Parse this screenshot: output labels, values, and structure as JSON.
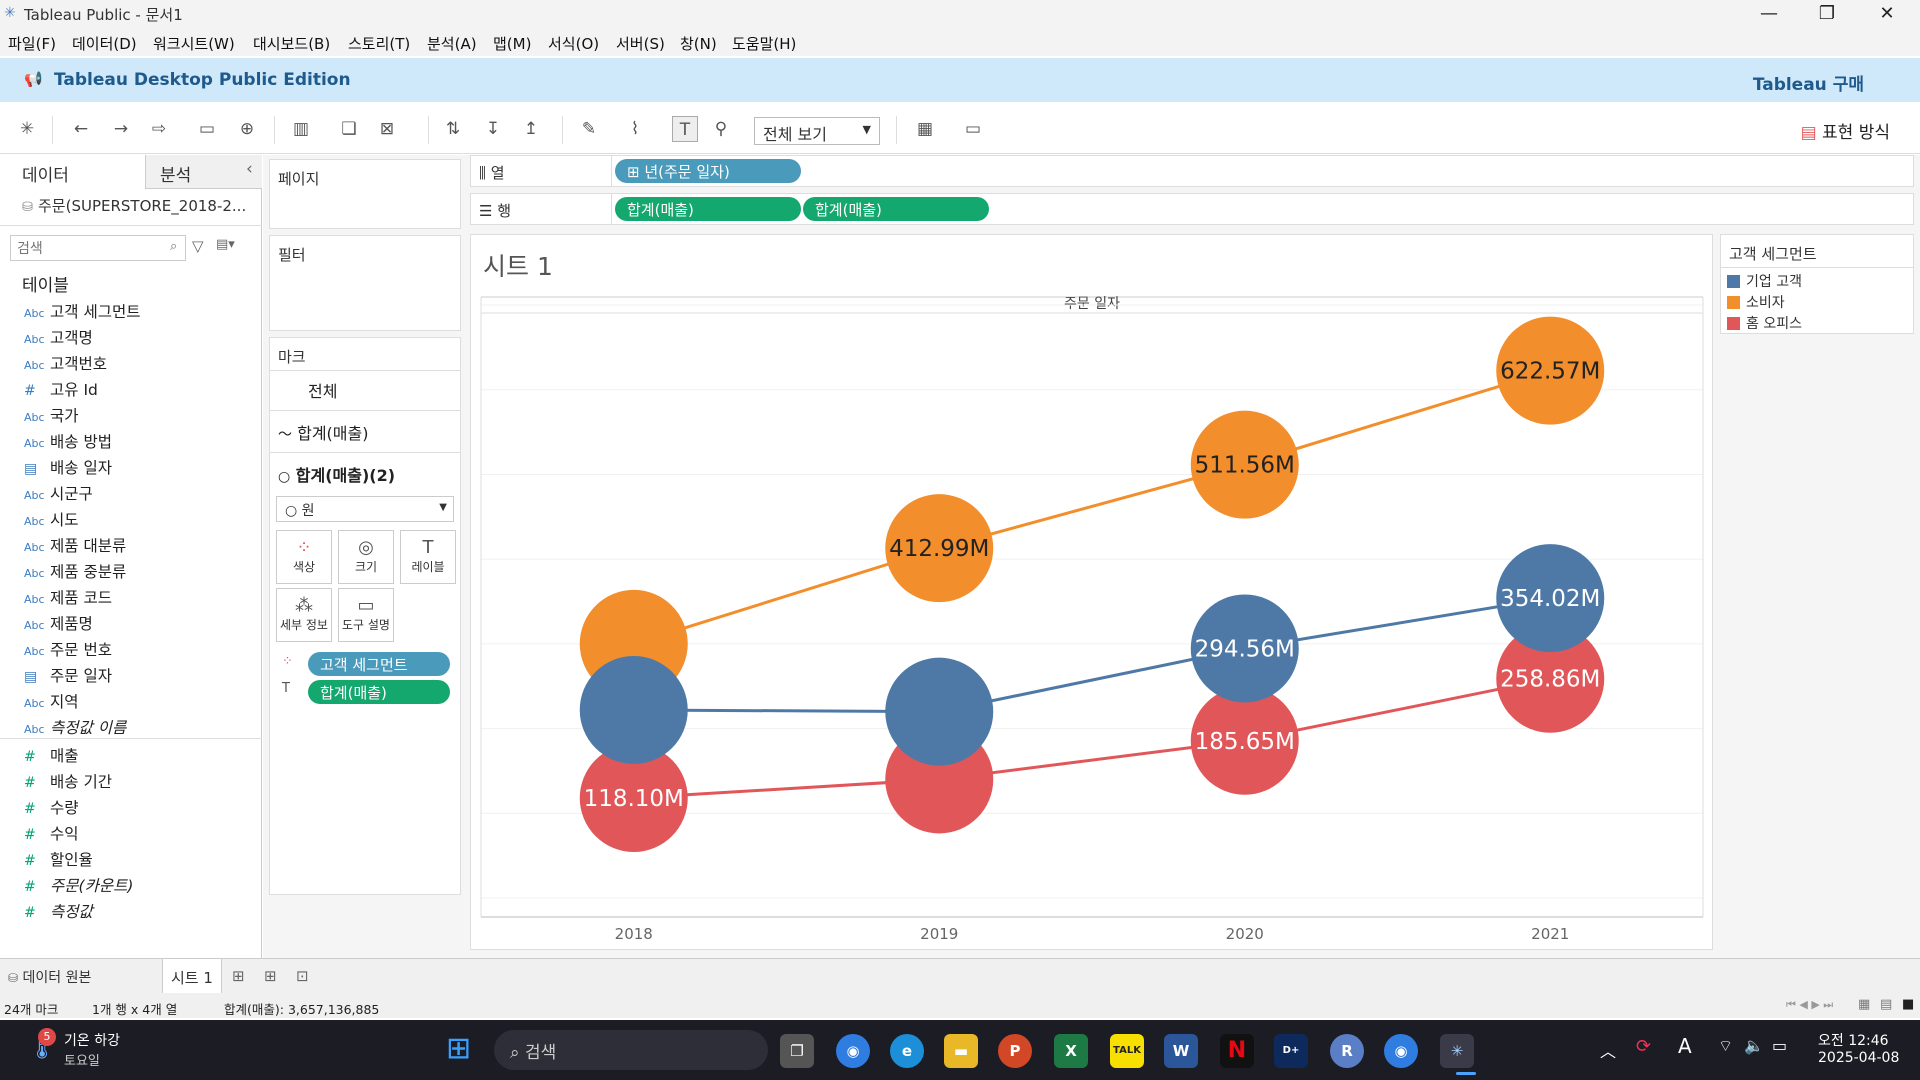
{
  "window": {
    "title": "Tableau Public - 문서1",
    "minimize": "—",
    "restore": "❐",
    "close": "✕"
  },
  "menu": [
    "파일(F)",
    "데이터(D)",
    "워크시트(W)",
    "대시보드(B)",
    "스토리(T)",
    "분석(A)",
    "맵(M)",
    "서식(O)",
    "서버(S)",
    "창(N)",
    "도움말(H)"
  ],
  "banner": {
    "brand": "Tableau Desktop Public Edition",
    "buy": "Tableau 구매"
  },
  "toolbar": {
    "view_select": "전체 보기",
    "show_me": "표현 방식"
  },
  "left_pane": {
    "tabs": [
      "데이터",
      "분석"
    ],
    "collapse": "‹",
    "datasource": "주문(SUPERSTORE_2018-2...",
    "search_placeholder": "검색",
    "tables_title": "테이블",
    "dimensions": [
      {
        "type": "Abc",
        "label": "고객 세그먼트"
      },
      {
        "type": "Abc",
        "label": "고객명"
      },
      {
        "type": "Abc",
        "label": "고객번호"
      },
      {
        "type": "#",
        "label": "고유 Id"
      },
      {
        "type": "Abc",
        "label": "국가"
      },
      {
        "type": "Abc",
        "label": "배송 방법"
      },
      {
        "type": "▤",
        "label": "배송 일자"
      },
      {
        "type": "Abc",
        "label": "시군구"
      },
      {
        "type": "Abc",
        "label": "시도"
      },
      {
        "type": "Abc",
        "label": "제품 대분류"
      },
      {
        "type": "Abc",
        "label": "제품 중분류"
      },
      {
        "type": "Abc",
        "label": "제품 코드"
      },
      {
        "type": "Abc",
        "label": "제품명"
      },
      {
        "type": "Abc",
        "label": "주문 번호"
      },
      {
        "type": "▤",
        "label": "주문 일자"
      },
      {
        "type": "Abc",
        "label": "지역"
      },
      {
        "type": "Abc",
        "label": "측정값 이름"
      }
    ],
    "measures": [
      {
        "type": "#",
        "label": "매출"
      },
      {
        "type": "#",
        "label": "배송 기간"
      },
      {
        "type": "#",
        "label": "수량"
      },
      {
        "type": "#",
        "label": "수익"
      },
      {
        "type": "#",
        "label": "할인율"
      },
      {
        "type": "#",
        "label": "주문(카운트)"
      },
      {
        "type": "#",
        "label": "측정값"
      }
    ]
  },
  "shelves": {
    "pages": "페이지",
    "filters": "필터",
    "marks": "마크",
    "marks_all": "전체",
    "marks_line": "합계(매출)",
    "marks_circle": "합계(매출)(2)",
    "mark_type": "원",
    "mark_buttons": [
      "색상",
      "크기",
      "레이블",
      "세부 정보",
      "도구 설명"
    ],
    "mark_pills": [
      "고객 세그먼트",
      "합계(매출)"
    ],
    "columns_label": "열",
    "rows_label": "행",
    "columns_pill": "⊞ 년(주문 일자)",
    "rows_pills": [
      "합계(매출)",
      "합계(매출)"
    ]
  },
  "sheet": {
    "title": "시트 1"
  },
  "legend": {
    "title": "고객 세그먼트",
    "items": [
      {
        "label": "기업 고객",
        "color": "#4e79a7"
      },
      {
        "label": "소비자",
        "color": "#f28e2b"
      },
      {
        "label": "홈 오피스",
        "color": "#e15759"
      }
    ]
  },
  "chart_data": {
    "type": "line",
    "title": "",
    "xlabel": "주문 일자",
    "ylabel": "",
    "x": [
      "2018",
      "2019",
      "2020",
      "2021"
    ],
    "ylim": [
      -20,
      700
    ],
    "grid": true,
    "legend": "right",
    "series": [
      {
        "name": "기업 고객",
        "color": "#4e79a7",
        "values": [
          222,
          220,
          294.56,
          354.02
        ],
        "labels": [
          "",
          "",
          "294.56M",
          "354.02M"
        ]
      },
      {
        "name": "소비자",
        "color": "#f28e2b",
        "values": [
          300,
          412.99,
          511.56,
          622.57
        ],
        "labels": [
          "",
          "412.99M",
          "511.56M",
          "622.57M"
        ]
      },
      {
        "name": "홈 오피스",
        "color": "#e15759",
        "values": [
          118.1,
          140,
          185.65,
          258.86
        ],
        "labels": [
          "118.10M",
          "",
          "185.65M",
          "258.86M"
        ]
      }
    ]
  },
  "bottom": {
    "datasource_tab": "데이터 원본",
    "sheet_tab": "시트 1"
  },
  "status": {
    "marks": "24개 마크",
    "rows_cols": "1개 행  x  4개 열",
    "sum": "합계(매출): 3,657,136,885"
  },
  "taskbar": {
    "weather_badge": "5",
    "weather": "기온 하강",
    "weather_day": "토요일",
    "search": "검색",
    "time": "오전 12:46",
    "date": "2025-04-08"
  }
}
